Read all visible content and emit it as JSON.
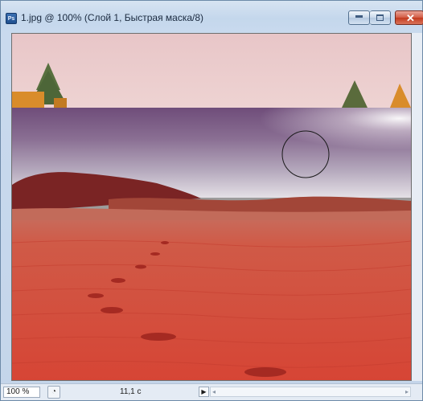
{
  "window": {
    "app_icon_text": "Ps",
    "title": "1.jpg @ 100% (Слой 1, Быстрая маска/8)",
    "minimize_icon": "minimize-icon",
    "maximize_icon": "maximize-icon",
    "close_glyph": "✕"
  },
  "canvas": {
    "image_description_icon": "photo-canvas",
    "quick_mask_color": "#d2302a",
    "brush_cursor_icon": "brush-cursor-icon"
  },
  "statusbar": {
    "zoom": "100 %",
    "menu_glyph": "◔",
    "doc_info": "11,1 c",
    "arrow_glyph": "▶",
    "scroll_left_glyph": "◂",
    "scroll_right_glyph": "▸"
  }
}
